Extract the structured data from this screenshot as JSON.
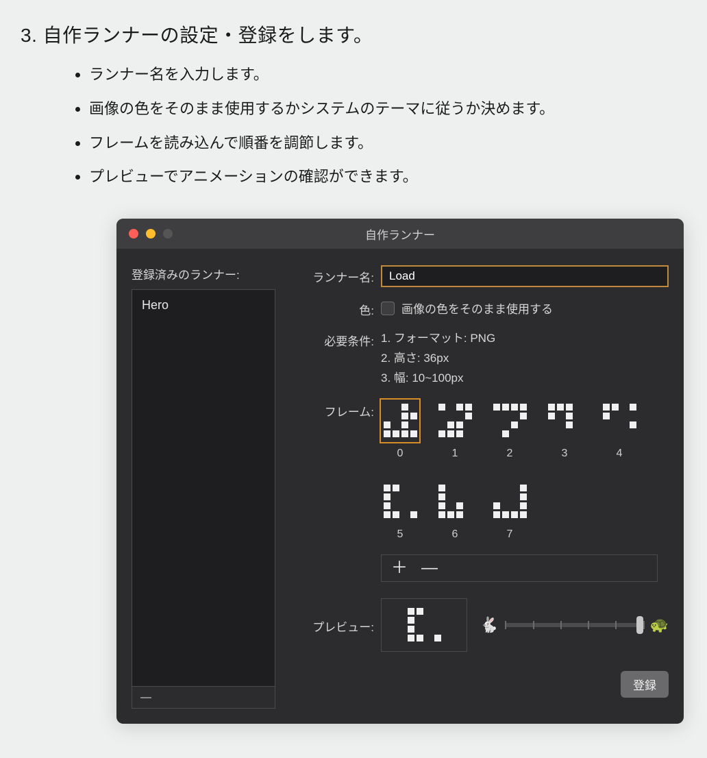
{
  "doc": {
    "heading": "3. 自作ランナーの設定・登録をします。",
    "bullets": [
      "ランナー名を入力します。",
      "画像の色をそのまま使用するかシステムのテーマに従うか決めます。",
      "フレームを読み込んで順番を調節します。",
      "プレビューでアニメーションの確認ができます。"
    ]
  },
  "window": {
    "title": "自作ランナー",
    "sidebar": {
      "label": "登録済みのランナー:",
      "items": [
        "Hero"
      ]
    },
    "form": {
      "name_label": "ランナー名:",
      "name_value": "Load",
      "color_label": "色:",
      "color_option": "画像の色をそのまま使用する",
      "color_checked": false,
      "requirements_label": "必要条件:",
      "requirements": [
        "1. フォーマット: PNG",
        "2. 高さ: 36px",
        "3. 幅: 10~100px"
      ],
      "frames_label": "フレーム:",
      "frames": [
        "0",
        "1",
        "2",
        "3",
        "4",
        "5",
        "6",
        "7"
      ],
      "frames_selected": 0,
      "frame_add": "＋",
      "frame_remove": "—",
      "preview_label": "プレビュー:",
      "speed_icons": {
        "fast": "🐇",
        "slow": "🐢"
      },
      "register": "登録"
    }
  }
}
